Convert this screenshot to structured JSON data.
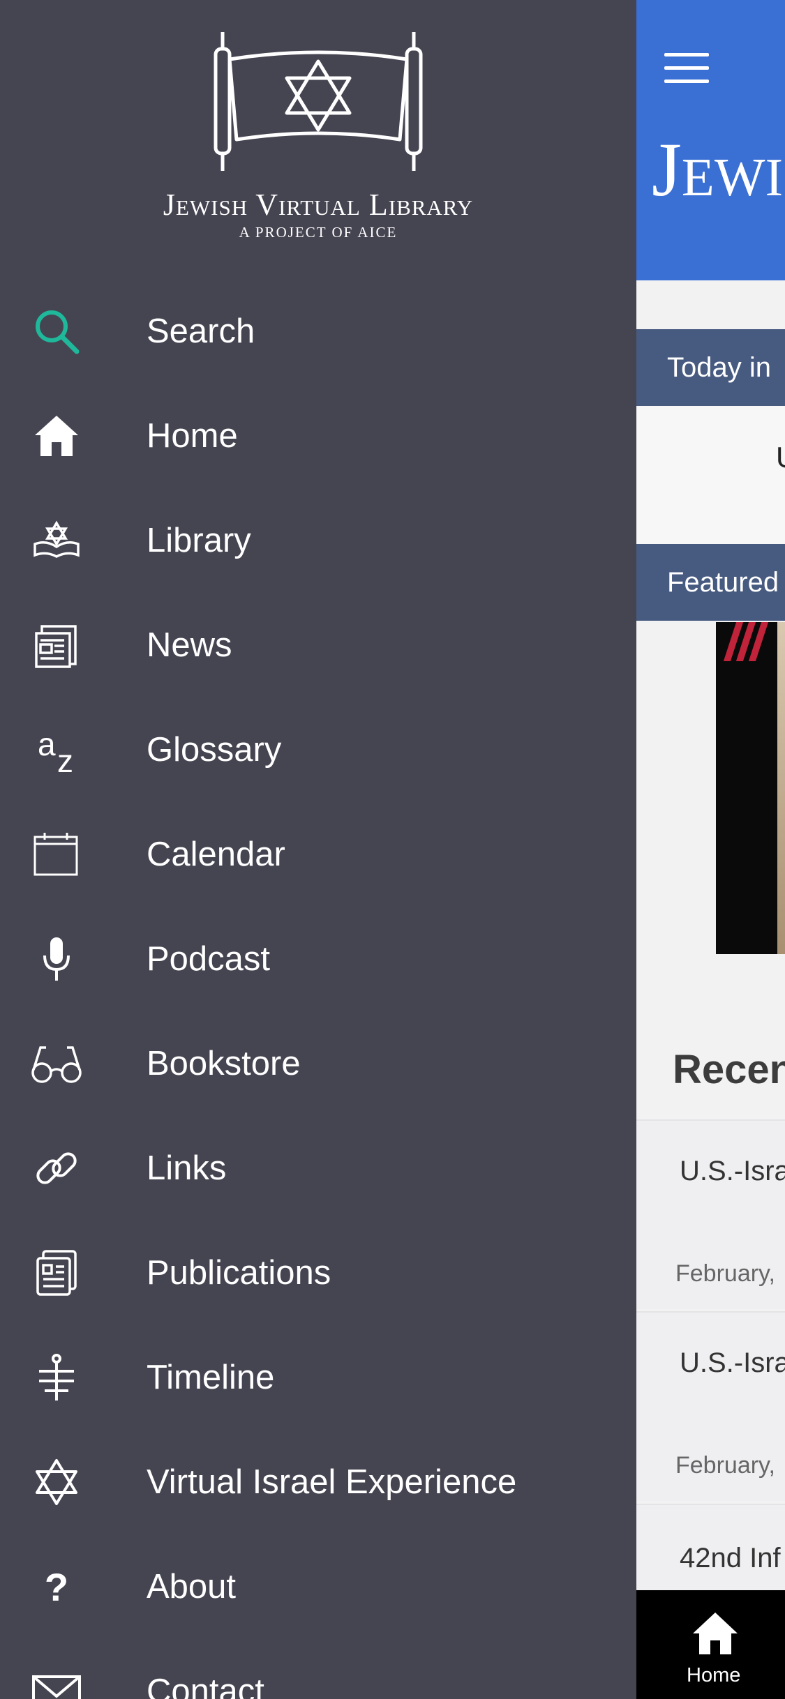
{
  "drawer": {
    "logo": {
      "title": "Jewish Virtual Library",
      "subtitle": "A PROJECT OF AICE"
    },
    "items": [
      {
        "label": "Search",
        "icon": "search-icon"
      },
      {
        "label": "Home",
        "icon": "home-icon"
      },
      {
        "label": "Library",
        "icon": "library-icon"
      },
      {
        "label": "News",
        "icon": "news-icon"
      },
      {
        "label": "Glossary",
        "icon": "glossary-icon"
      },
      {
        "label": "Calendar",
        "icon": "calendar-icon"
      },
      {
        "label": "Podcast",
        "icon": "microphone-icon"
      },
      {
        "label": "Bookstore",
        "icon": "glasses-icon"
      },
      {
        "label": "Links",
        "icon": "link-icon"
      },
      {
        "label": "Publications",
        "icon": "publications-icon"
      },
      {
        "label": "Timeline",
        "icon": "timeline-icon"
      },
      {
        "label": "Virtual Israel Experience",
        "icon": "star-of-david-icon"
      },
      {
        "label": "About",
        "icon": "question-icon"
      },
      {
        "label": "Contact",
        "icon": "mail-icon"
      }
    ],
    "glossary_glyph_a": "a",
    "glossary_glyph_z": "z",
    "about_glyph": "?"
  },
  "main": {
    "header_title": "Jewi",
    "today_label": "Today in",
    "today_text": "U",
    "featured_label": "Featured",
    "recent_title": "Recen",
    "recent_items": [
      {
        "headline": "U.S.-Isra",
        "date": "February,"
      },
      {
        "headline": "U.S.-Isra",
        "date": "February,"
      },
      {
        "headline": "42nd Inf",
        "date": ""
      }
    ],
    "tab_home_label": "Home"
  },
  "colors": {
    "drawer_bg": "#454451",
    "header_blue": "#3a6fd4",
    "section_bar": "#475a80",
    "search_accent": "#1fb89a"
  }
}
